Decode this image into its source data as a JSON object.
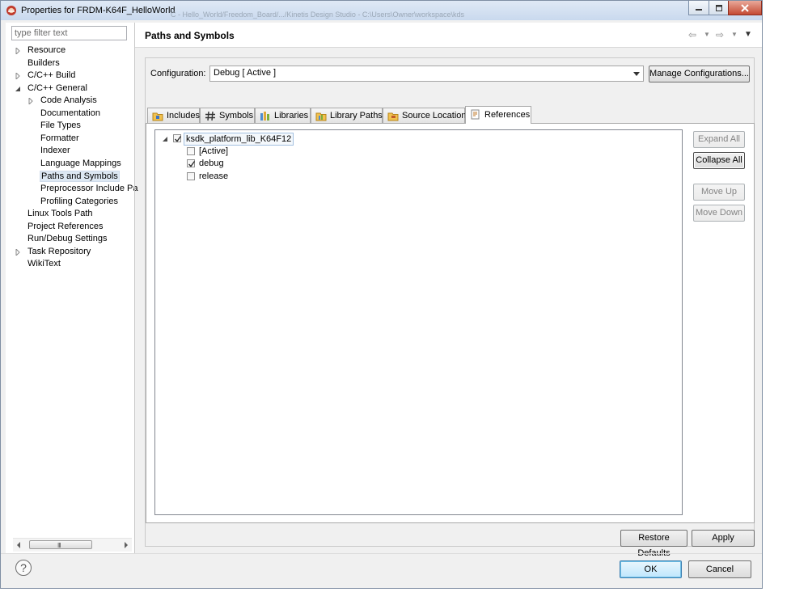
{
  "window": {
    "title": "Properties for FRDM-K64F_HelloWorld",
    "background_title": "C - Hello_World/Freedom_Board/.../Kinetis Design Studio - C:\\Users\\Owner\\workspace\\kds"
  },
  "filter": {
    "placeholder": "type filter text",
    "value": ""
  },
  "tree": [
    {
      "label": "Resource",
      "expander": "collapsed"
    },
    {
      "label": "Builders",
      "expander": "none"
    },
    {
      "label": "C/C++ Build",
      "expander": "collapsed"
    },
    {
      "label": "C/C++ General",
      "expander": "expanded"
    },
    {
      "label": "Code Analysis",
      "expander": "collapsed"
    },
    {
      "label": "Documentation",
      "expander": "none"
    },
    {
      "label": "File Types",
      "expander": "none"
    },
    {
      "label": "Formatter",
      "expander": "none"
    },
    {
      "label": "Indexer",
      "expander": "none"
    },
    {
      "label": "Language Mappings",
      "expander": "none"
    },
    {
      "label": "Paths and Symbols",
      "expander": "none",
      "selected": true
    },
    {
      "label": "Preprocessor Include Pa",
      "expander": "none"
    },
    {
      "label": "Profiling Categories",
      "expander": "none"
    },
    {
      "label": "Linux Tools Path",
      "expander": "none"
    },
    {
      "label": "Project References",
      "expander": "none"
    },
    {
      "label": "Run/Debug Settings",
      "expander": "none"
    },
    {
      "label": "Task Repository",
      "expander": "collapsed"
    },
    {
      "label": "WikiText",
      "expander": "none"
    }
  ],
  "page": {
    "title": "Paths and Symbols",
    "configuration_label": "Configuration:",
    "configuration_value": "Debug  [ Active ]",
    "manage_button": "Manage Configurations..."
  },
  "tabs": [
    {
      "label": "Includes",
      "icon": "includes-icon"
    },
    {
      "label": "Symbols",
      "icon": "hash-icon"
    },
    {
      "label": "Libraries",
      "icon": "libraries-icon"
    },
    {
      "label": "Library Paths",
      "icon": "library-paths-icon"
    },
    {
      "label": "Source Location",
      "icon": "source-folder-icon"
    },
    {
      "label": "References",
      "icon": "references-icon",
      "active": true
    }
  ],
  "references": {
    "project": {
      "label": "ksdk_platform_lib_K64F12",
      "checked": true
    },
    "configs": [
      {
        "label": "[Active]",
        "checked": false
      },
      {
        "label": "debug",
        "checked": true
      },
      {
        "label": "release",
        "checked": false
      }
    ]
  },
  "side_buttons": {
    "expand_all": "Expand All",
    "collapse_all": "Collapse All",
    "move_up": "Move Up",
    "move_down": "Move Down"
  },
  "footer": {
    "restore_defaults": "Restore Defaults",
    "apply": "Apply",
    "ok": "OK",
    "cancel": "Cancel",
    "help": "?"
  },
  "scrollbar": {
    "grip": "III"
  },
  "colors": {
    "titlebar": "#c9d9ee",
    "selection": "#dde8f3",
    "default_button": "#bee6fd"
  }
}
